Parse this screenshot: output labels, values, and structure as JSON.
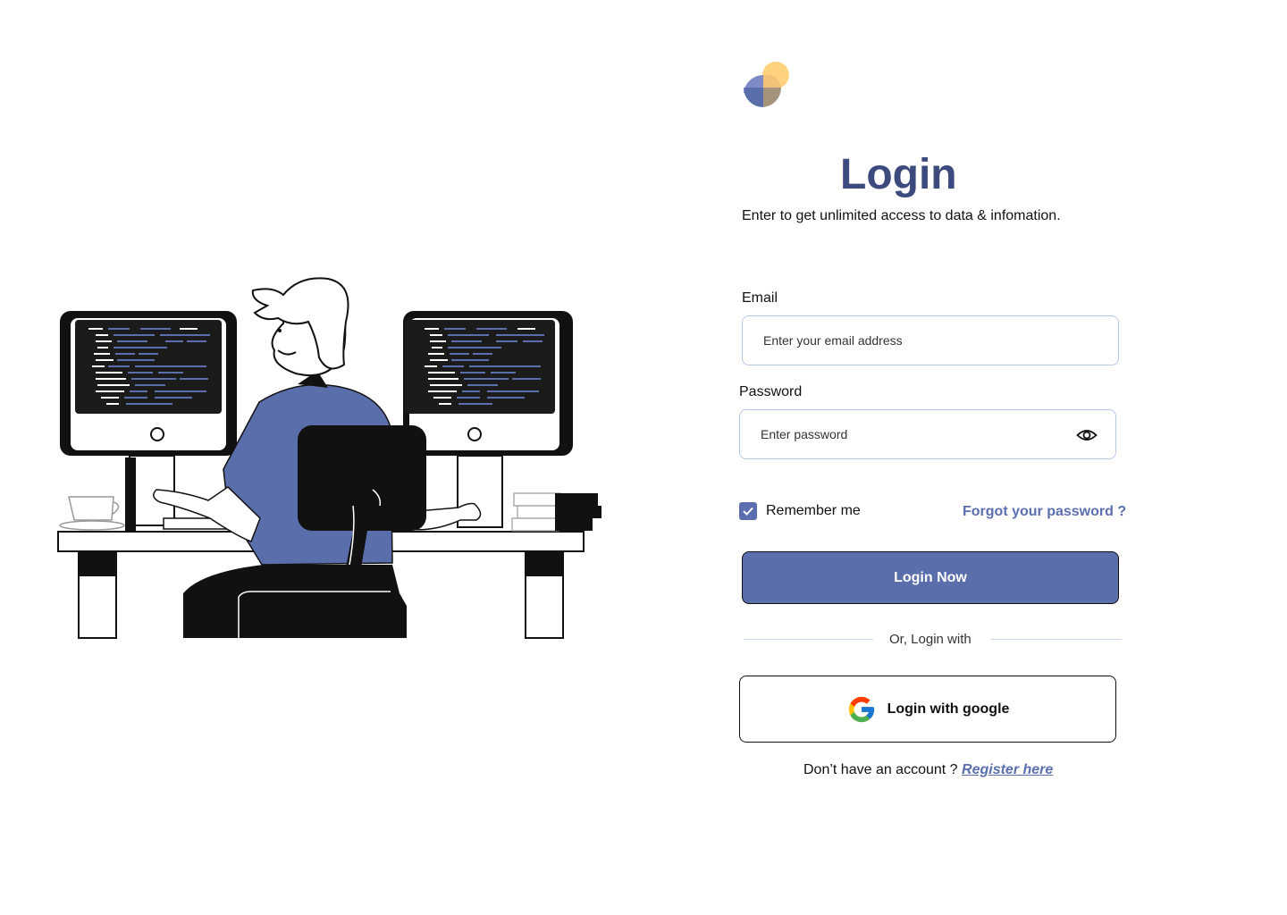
{
  "login": {
    "title": "Login",
    "subtitle": "Enter to get unlimited access to data & infomation.",
    "email_label": "Email",
    "email_placeholder": "Enter your email address",
    "email_value": "",
    "password_label": "Password",
    "password_placeholder": "Enter password",
    "password_value": "",
    "remember_label": "Remember me",
    "remember_checked": true,
    "forgot_label": "Forgot your password ?",
    "submit_label": "Login Now",
    "divider_label": "Or, Login with",
    "google_label": "Login with google",
    "register_prompt": "Don’t have an account ?",
    "register_link": "Register here"
  },
  "colors": {
    "accent": "#5b6eac",
    "title": "#3d4a7e",
    "field_border": "#b7c8e6",
    "logo_yellow": "#ffd27f",
    "logo_purple": "#7f8bc6",
    "logo_brown": "#a4947c"
  },
  "icons": {
    "logo": "brand-logo-icon",
    "password_toggle": "eye-icon",
    "checkbox": "check-icon",
    "google": "google-icon",
    "illustration": "developer-at-desk-illustration"
  }
}
